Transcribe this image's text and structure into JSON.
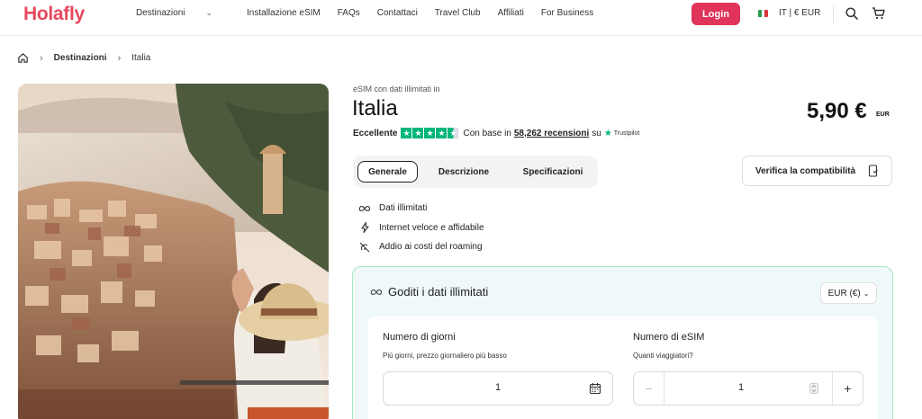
{
  "brand": {
    "logo": "Holafly",
    "accent": "#e0345a",
    "logo_color": "#e6485c"
  },
  "nav": {
    "items": [
      {
        "label": "Destinazioni",
        "has_dropdown": true
      },
      {
        "label": "Installazione eSIM"
      },
      {
        "label": "FAQs"
      },
      {
        "label": "Contattaci"
      },
      {
        "label": "Travel Club"
      },
      {
        "label": "Affiliati"
      },
      {
        "label": "For Business"
      }
    ],
    "login": "Login",
    "locale": "IT | € EUR",
    "icons": [
      "search-icon",
      "cart-icon"
    ]
  },
  "breadcrumb": {
    "home_icon": "home-icon",
    "items": [
      "Destinazioni",
      "Italia"
    ]
  },
  "product": {
    "subtitle": "eSIM con dati illimitati in",
    "title": "Italia",
    "price": "5,90 €",
    "currency": "EUR",
    "rating": {
      "label": "Eccellente",
      "based_on": "Con base in",
      "reviews": "58,262 recensioni",
      "on": "su",
      "platform": "Trustpilot",
      "stars": 4.5,
      "star_color": "#00b67a"
    }
  },
  "tabs": {
    "items": [
      "Generale",
      "Descrizione",
      "Specificazioni"
    ],
    "active": 0
  },
  "compatibility_button": "Verifica la compatibilità",
  "features": [
    {
      "icon": "infinity-icon",
      "label": "Dati illimitati"
    },
    {
      "icon": "bolt-icon",
      "label": "Internet veloce e affidabile"
    },
    {
      "icon": "no-roaming-icon",
      "label": "Addio ai costi del roaming"
    }
  ],
  "plan": {
    "header": "Goditi i dati illimitati",
    "currency_select": "EUR (€)",
    "days": {
      "label": "Numero di giorni",
      "hint": "Più giorni, prezzo giornaliero più basso",
      "value": "1"
    },
    "esims": {
      "label": "Numero di eSIM",
      "hint": "Quanti viaggiatori?",
      "value": "1",
      "minus": "−",
      "plus": "+"
    }
  }
}
